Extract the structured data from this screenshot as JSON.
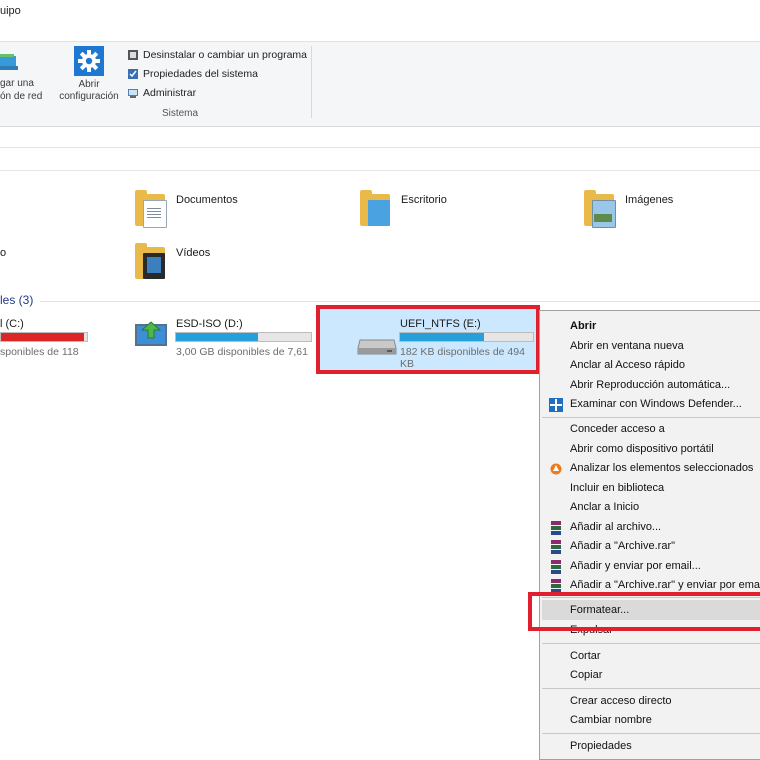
{
  "window": {
    "title_fragment": "uipo"
  },
  "ribbon": {
    "network_label_line1": "gar una",
    "network_label_line2": "ón de red",
    "open_config_line1": "Abrir",
    "open_config_line2": "configuración",
    "commands": [
      "Desinstalar o cambiar un programa",
      "Propiedades del sistema",
      "Administrar"
    ],
    "group_label": "Sistema"
  },
  "folders": [
    {
      "name": "Documentos"
    },
    {
      "name": "Escritorio"
    },
    {
      "name": "Imágenes"
    },
    {
      "name": "Vídeos"
    }
  ],
  "partial_folder_label": "o",
  "devices_header": "les (3)",
  "drives": [
    {
      "name": "l (C:)",
      "space": "sponibles de 118",
      "fill_fraction": 0.97,
      "bar_color": "#da2626"
    },
    {
      "name": "ESD-ISO (D:)",
      "space": "3,00 GB disponibles de 7,61",
      "fill_fraction": 0.61,
      "bar_color": "#26a0da"
    },
    {
      "name": "UEFI_NTFS (E:)",
      "space": "182 KB disponibles de 494 KB",
      "fill_fraction": 0.63,
      "bar_color": "#26a0da"
    }
  ],
  "context_menu": {
    "items": [
      {
        "label": "Abrir",
        "bold": true
      },
      {
        "label": "Abrir en ventana nueva"
      },
      {
        "label": "Anclar al Acceso rápido"
      },
      {
        "label": "Abrir Reproducción automática..."
      },
      {
        "label": "Examinar con Windows Defender...",
        "icon": "windows-defender-icon"
      },
      {
        "label": "Conceder acceso a"
      },
      {
        "label": "Abrir como dispositivo portátil"
      },
      {
        "label": "Analizar los elementos seleccionados",
        "icon": "avast-icon"
      },
      {
        "label": "Incluir en biblioteca"
      },
      {
        "label": "Anclar a Inicio"
      },
      {
        "label": "Añadir al archivo...",
        "icon": "winrar-icon"
      },
      {
        "label": "Añadir a \"Archive.rar\"",
        "icon": "winrar-icon"
      },
      {
        "label": "Añadir y enviar por email...",
        "icon": "winrar-icon"
      },
      {
        "label": "Añadir a \"Archive.rar\" y enviar por email",
        "icon": "winrar-icon"
      },
      {
        "label": "Formatear...",
        "highlighted": true
      },
      {
        "label": "Expulsar"
      },
      {
        "label": "Cortar"
      },
      {
        "label": "Copiar"
      },
      {
        "label": "Crear acceso directo"
      },
      {
        "label": "Cambiar nombre"
      },
      {
        "label": "Propiedades"
      }
    ]
  },
  "colors": {
    "highlight_border": "#e0202c",
    "selection": "#cce8ff",
    "accent": "#26a0da"
  }
}
